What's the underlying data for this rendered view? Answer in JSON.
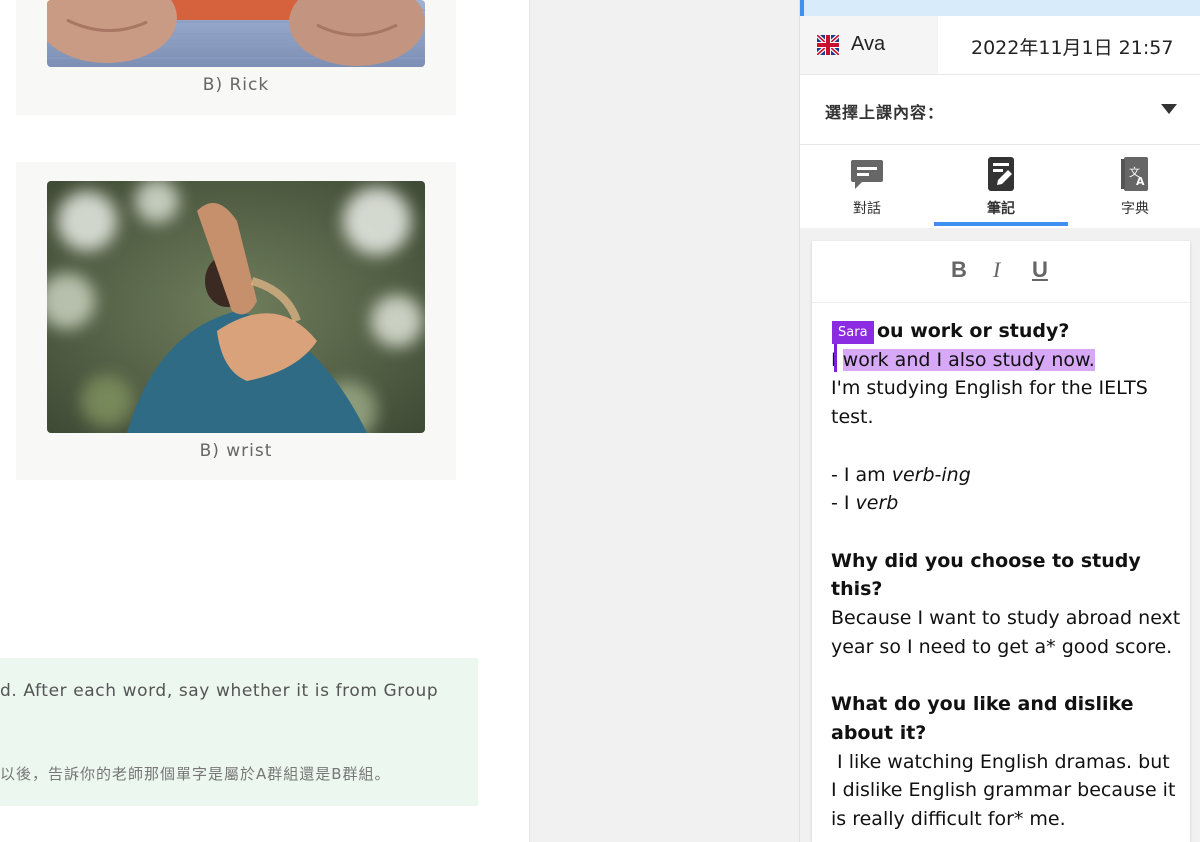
{
  "lesson": {
    "cards": [
      {
        "caption": "B) Rick",
        "image": "fists-photo"
      },
      {
        "caption": "B) wrist",
        "image": "wrist-photo"
      }
    ],
    "instruction_en": "d. After each word, say whether it is from Group",
    "instruction_zh": "以後，告訴你的老師那個單字是屬於A群組還是B群組。"
  },
  "panel": {
    "user_name": "Ava",
    "flag_icon": "uk-flag-icon",
    "datetime": "2022年11月1日 21:57",
    "selector_label": "選擇上課內容：",
    "tabs": [
      {
        "label": "對話",
        "icon": "chat-icon"
      },
      {
        "label": "筆記",
        "icon": "note-edit-icon",
        "active": true
      },
      {
        "label": "字典",
        "icon": "dictionary-icon"
      }
    ],
    "toolbar": {
      "bold": "B",
      "italic": "I",
      "underline": "U"
    },
    "collaborator": {
      "name": "Sara",
      "color": "#8b2be2"
    },
    "note": {
      "q1": "Do you work or study?",
      "q1_visible": "ou work or study?",
      "a1_first": "I",
      "a1_highlight": "work and I also study now.",
      "a1_line2": "I'm studying English for the IELTS test.",
      "list1_prefix": "- I am ",
      "list1_italic": "verb-ing",
      "list2_prefix": "- I ",
      "list2_italic": "verb",
      "q2": "Why did you choose to study this?",
      "a2": "Because I want to study abroad next year so I need to get a* good score.",
      "q3": "What do you like and dislike about it?",
      "a3": " I like watching English dramas. but I dislike English grammar because it is really difficult for* me."
    },
    "accent_color": "#3d8ff0"
  }
}
